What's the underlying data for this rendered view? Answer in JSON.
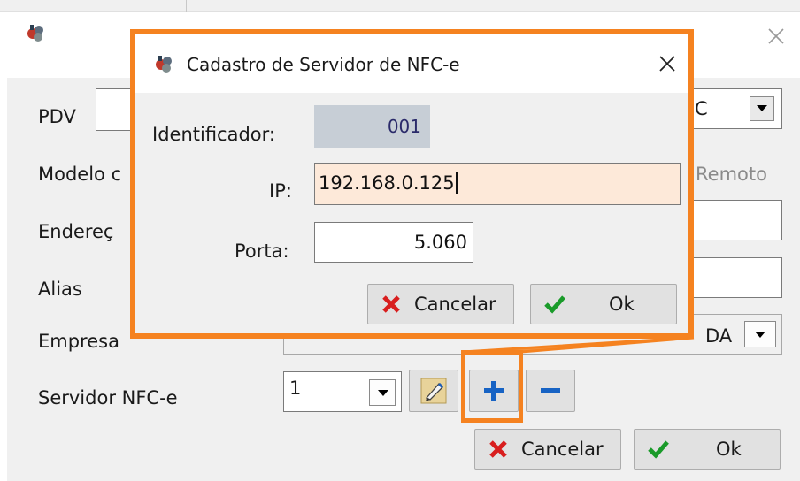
{
  "bg": {
    "labels": {
      "pdv": "PDV",
      "modelo": "Modelo c",
      "endereco": "Endereç",
      "alias": "Alias",
      "empresa": "Empresa",
      "servidor": "Servidor NFC-e"
    },
    "right_partials": {
      "combo_text": "C",
      "remoto": "Remoto",
      "empresa_text": "DA"
    },
    "servidor_value": "1",
    "cancel_label": "Cancelar",
    "ok_label": "Ok"
  },
  "dialog": {
    "title": "Cadastro de Servidor de NFC-e",
    "identificador_label": "Identificador:",
    "identificador_value": "001",
    "ip_label": "IP:",
    "ip_value": "192.168.0.125",
    "porta_label": "Porta:",
    "porta_value": "5.060",
    "cancel_label": "Cancelar",
    "ok_label": "Ok"
  },
  "colors": {
    "highlight": "#f58220",
    "ip_field_bg": "#fde9d9",
    "identificador_bg": "#c7ced6"
  }
}
